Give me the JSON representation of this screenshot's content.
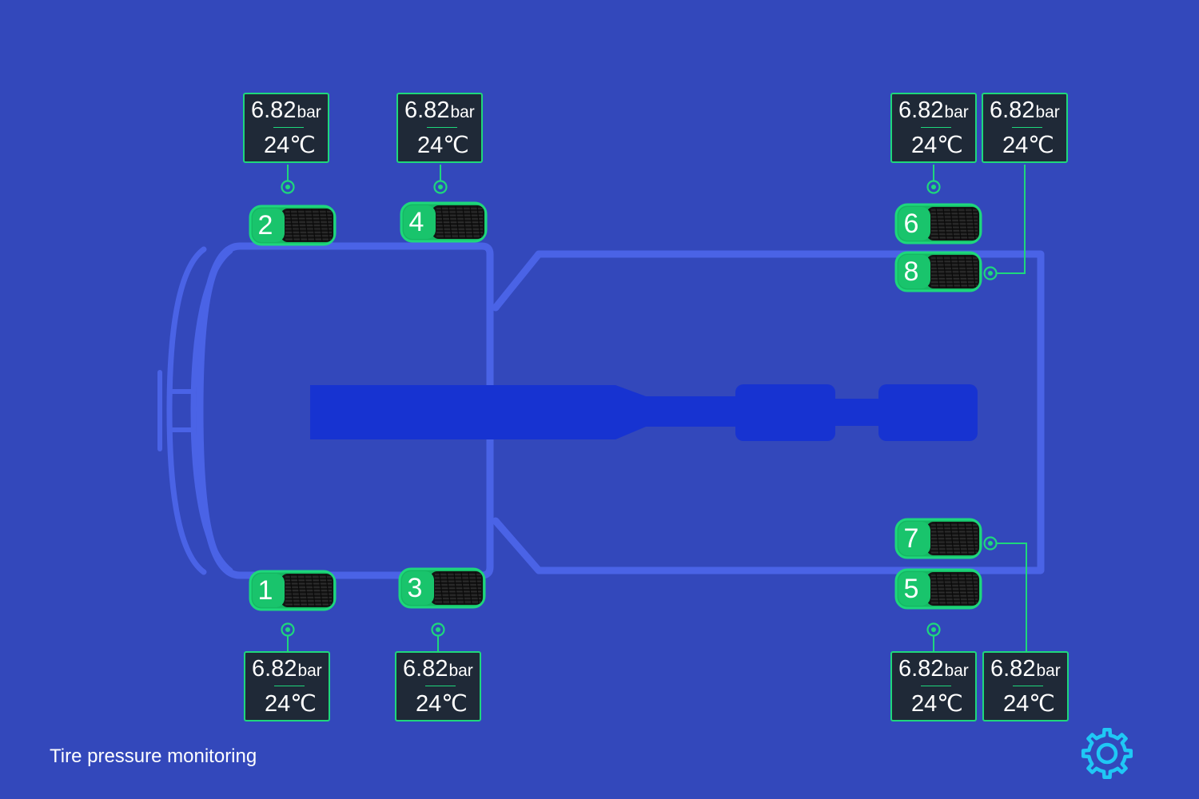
{
  "footer": {
    "title": "Tire pressure monitoring"
  },
  "units": {
    "pressure": "bar",
    "temperature": "℃"
  },
  "colors": {
    "background": "#3348bb",
    "chassis_outline": "#4a63e6",
    "driveshaft": "#1733d1",
    "accent": "#1ed77c",
    "readout_bg": "#1f2937",
    "settings_icon": "#1fc8f5"
  },
  "icons": {
    "settings": "gear-icon",
    "sensor": "sensor-dot-icon"
  },
  "tires": [
    {
      "number": "1",
      "pressure": "6.82",
      "temperature": "24"
    },
    {
      "number": "2",
      "pressure": "6.82",
      "temperature": "24"
    },
    {
      "number": "3",
      "pressure": "6.82",
      "temperature": "24"
    },
    {
      "number": "4",
      "pressure": "6.82",
      "temperature": "24"
    },
    {
      "number": "5",
      "pressure": "6.82",
      "temperature": "24"
    },
    {
      "number": "6",
      "pressure": "6.82",
      "temperature": "24"
    },
    {
      "number": "7",
      "pressure": "6.82",
      "temperature": "24"
    },
    {
      "number": "8",
      "pressure": "6.82",
      "temperature": "24"
    }
  ]
}
